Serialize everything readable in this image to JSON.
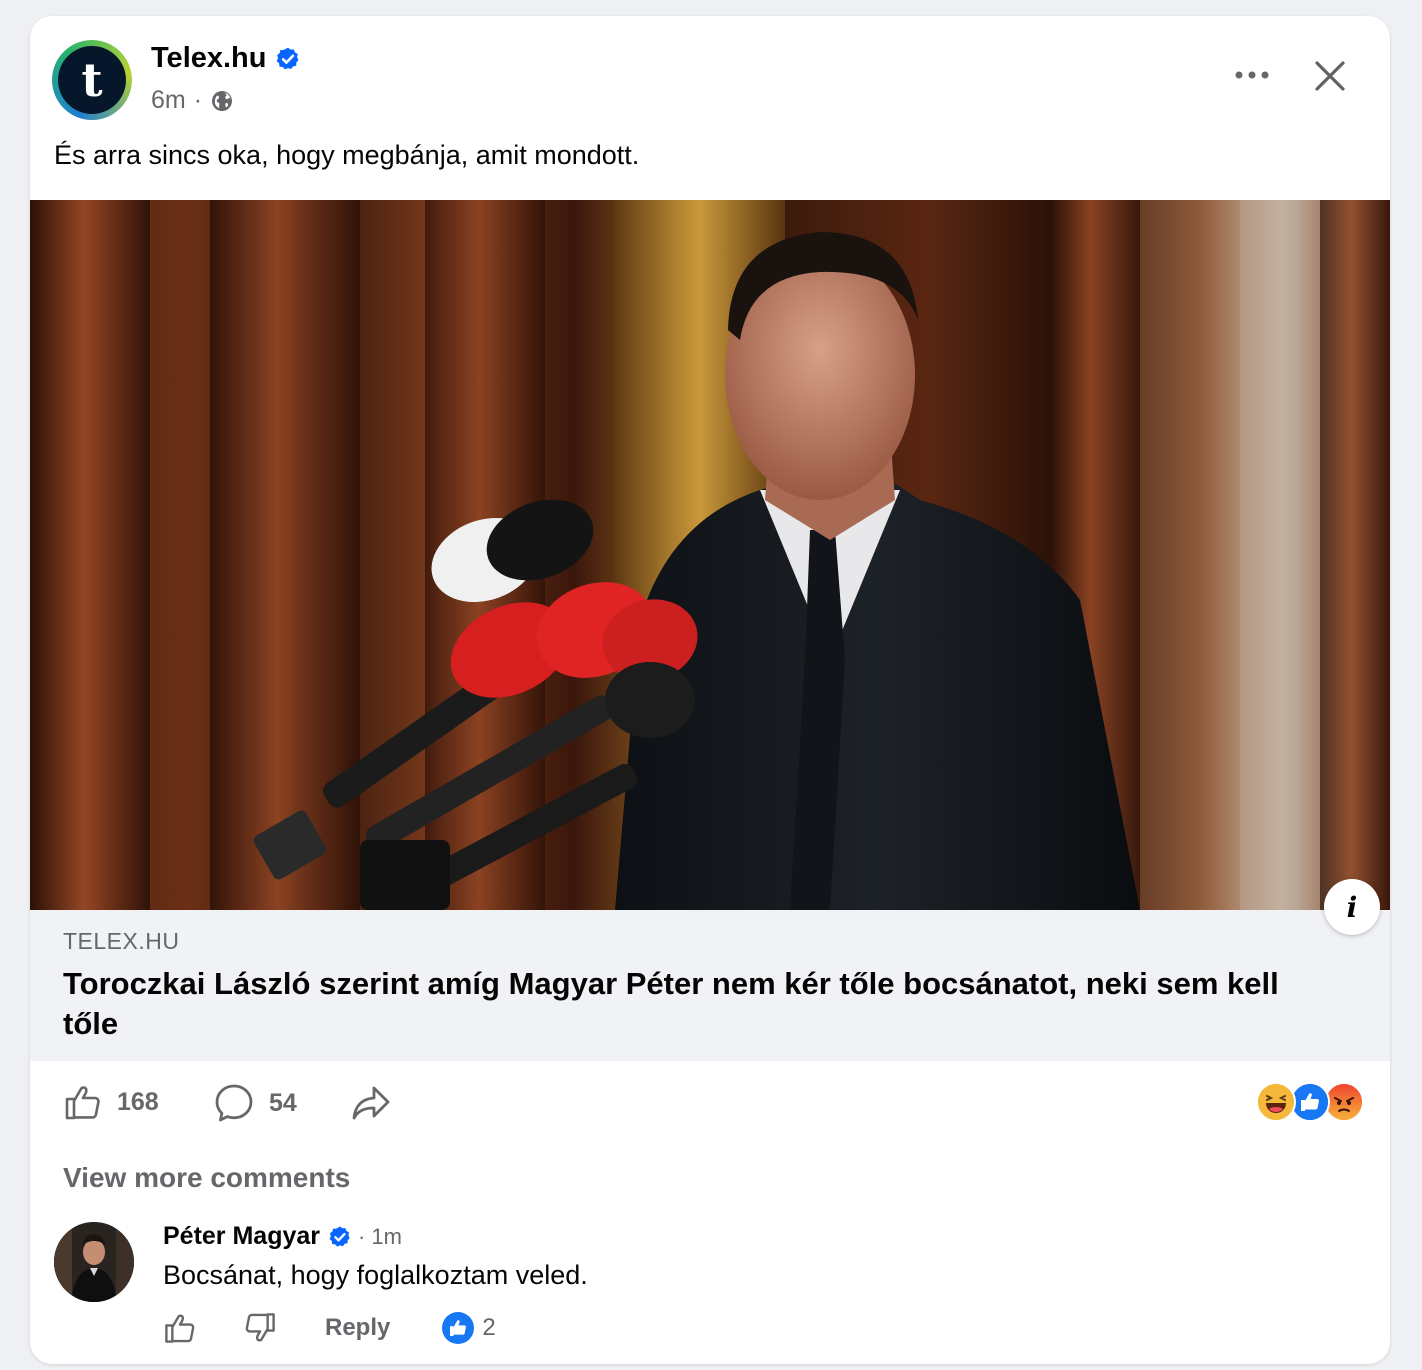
{
  "post": {
    "page_name": "Telex.hu",
    "avatar_letter": "t",
    "time": "6m",
    "separator": "·",
    "privacy_icon": "globe-icon",
    "text": "És arra sincs oka, hogy megbánja, amit mondott."
  },
  "link": {
    "domain": "TELEX.HU",
    "title": "Toroczkai László szerint amíg Magyar Péter nem kér tőle bocsánatot, neki sem kell tőle",
    "info_label": "i"
  },
  "actions": {
    "like_count": "168",
    "comment_count": "54",
    "reactions": [
      "haha",
      "like",
      "angry"
    ]
  },
  "comments": {
    "view_more_label": "View more comments",
    "items": [
      {
        "author": "Péter Magyar",
        "separator": "·",
        "time": "1m",
        "text": "Bocsánat, hogy foglalkoztam veled.",
        "reply_label": "Reply",
        "like_count": "2"
      }
    ]
  },
  "colors": {
    "facebook_blue": "#0866ff",
    "secondary_text": "#65676b",
    "card_bg": "#ffffff",
    "page_bg": "#eef0f3",
    "link_preview_bg": "#f0f2f5"
  }
}
